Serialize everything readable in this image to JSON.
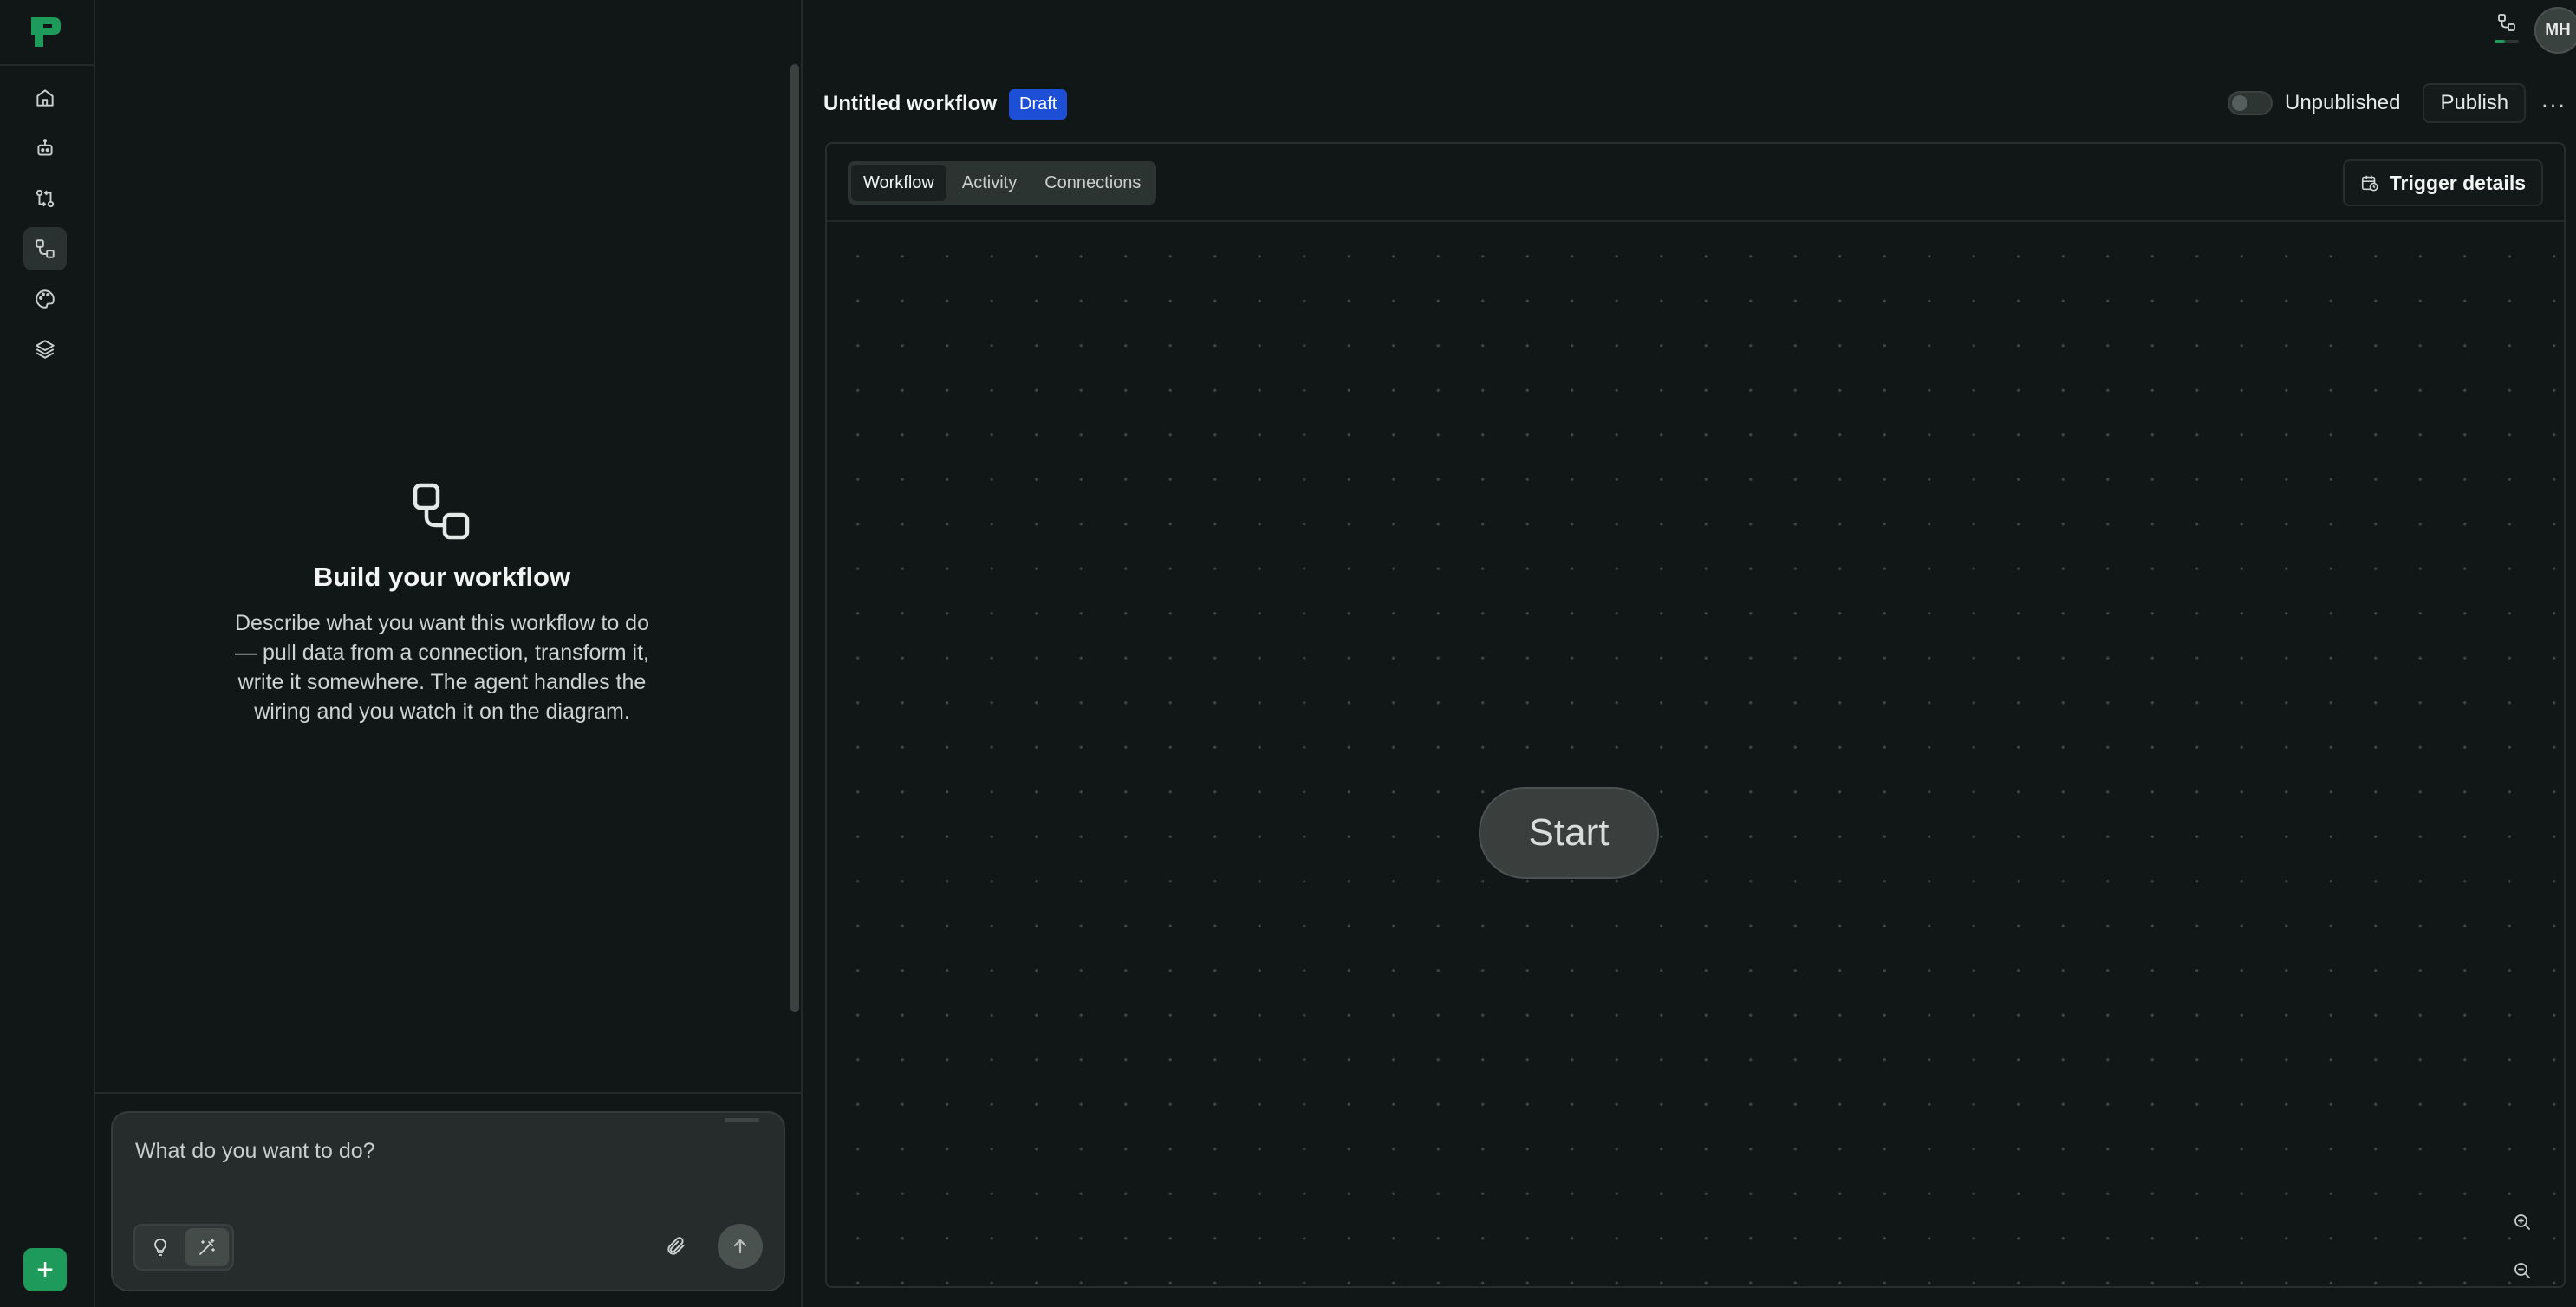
{
  "nav": {
    "items": [
      {
        "name": "home",
        "icon": "home-icon"
      },
      {
        "name": "agents",
        "icon": "robot-icon"
      },
      {
        "name": "pipelines",
        "icon": "pipeline-icon"
      },
      {
        "name": "workflows",
        "icon": "workflow-icon",
        "active": true
      },
      {
        "name": "themes",
        "icon": "palette-icon"
      },
      {
        "name": "layers",
        "icon": "layers-icon"
      }
    ],
    "add_label": "+"
  },
  "chat": {
    "empty_title": "Build your workflow",
    "empty_description": "Describe what you want this workflow to do — pull data from a connection, transform it, write it somewhere. The agent handles the wiring and you watch it on the diagram.",
    "input_placeholder": "What do you want to do?"
  },
  "user": {
    "initials": "MH"
  },
  "workflow": {
    "title": "Untitled workflow",
    "status_badge": "Draft",
    "publish_state_label": "Unpublished",
    "publish_label": "Publish",
    "more_label": "···"
  },
  "canvas": {
    "tabs": [
      {
        "label": "Workflow",
        "active": true
      },
      {
        "label": "Activity",
        "active": false
      },
      {
        "label": "Connections",
        "active": false
      }
    ],
    "trigger_label": "Trigger details",
    "start_node_label": "Start"
  },
  "colors": {
    "accent": "#1e9a5a",
    "draft_badge": "#1d4fd6",
    "background": "#111716"
  }
}
